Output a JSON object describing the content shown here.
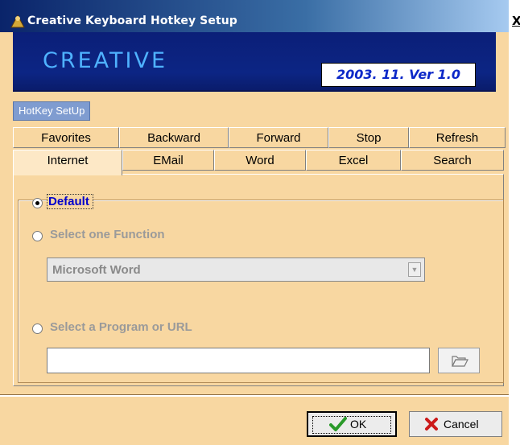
{
  "window": {
    "title": "Creative Keyboard Hotkey Setup",
    "close_label": "X"
  },
  "banner": {
    "logo": "CREATIVE",
    "version": "2003. 11.  Ver 1.0"
  },
  "section_label": "HotKey SetUp",
  "tabs": {
    "row_back": [
      "Favorites",
      "Backward",
      "Forward",
      "Stop",
      "Refresh"
    ],
    "row_front": [
      "Internet",
      "EMail",
      "Word",
      "Excel",
      "Search"
    ],
    "active": "Internet"
  },
  "options": {
    "default_label": "Default",
    "default_selected": true,
    "function_label": "Select one Function",
    "function_selected": false,
    "function_value": "Microsoft Word",
    "program_label": "Select a Program or  URL",
    "program_selected": false,
    "program_value": ""
  },
  "buttons": {
    "ok_label": "OK",
    "cancel_label": "Cancel"
  },
  "colors": {
    "dialog_bg": "#f8d7a1",
    "banner_bg": "#0c2584",
    "logo": "#4fb2ff",
    "accent": "#0000cc",
    "ok_check": "#2a9a2a",
    "cancel_x": "#cc1a1a"
  },
  "icons": {
    "title": "creative-app-icon",
    "browse": "folder-open-icon",
    "ok": "checkmark-icon",
    "cancel": "x-mark-icon",
    "dropdown": "chevron-down-icon"
  }
}
